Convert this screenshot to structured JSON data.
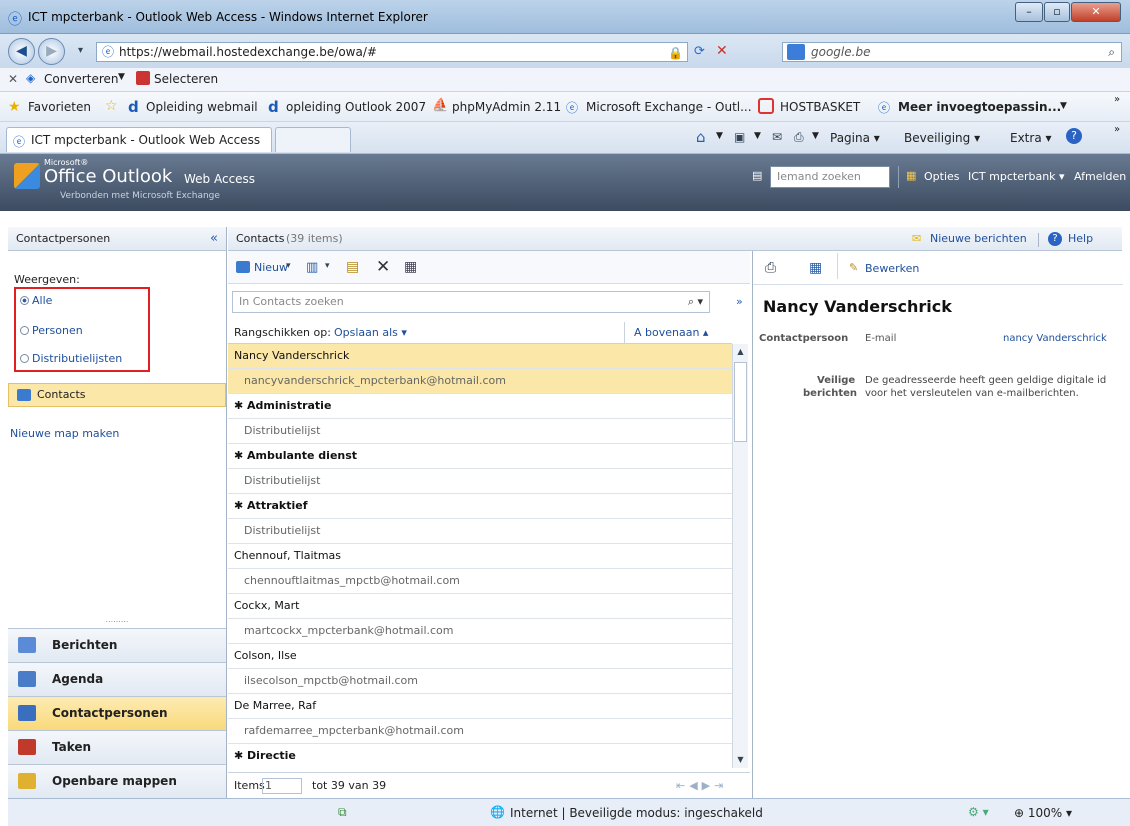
{
  "window": {
    "title": "ICT mpcterbank - Outlook Web Access - Windows Internet Explorer"
  },
  "address": {
    "url": "https://webmail.hostedexchange.be/owa/#"
  },
  "search": {
    "value": "google.be"
  },
  "conv": {
    "convert_label": "Converteren",
    "select_label": "Selecteren"
  },
  "favorites": {
    "label": "Favorieten",
    "items": [
      "Opleiding webmail",
      "opleiding Outlook 2007",
      "phpMyAdmin 2.11",
      "Microsoft Exchange - Outl...",
      "HOSTBASKET",
      "Meer invoegtoepassin..."
    ]
  },
  "tabs": {
    "active": "ICT mpcterbank - Outlook Web Access",
    "pagina": "Pagina",
    "beveiliging": "Beveiliging",
    "extra": "Extra"
  },
  "owa": {
    "logo_small": "Microsoft®",
    "logo_main": "Office Outlook",
    "logo_sub": "Web Access",
    "connected": "Verbonden met Microsoft Exchange",
    "search_placeholder": "Iemand zoeken",
    "opties": "Opties",
    "user": "ICT mpcterbank",
    "afmelden": "Afmelden"
  },
  "left": {
    "header": "Contactpersonen",
    "weergeven": "Weergeven:",
    "options": [
      "Alle",
      "Personen",
      "Distributielijsten"
    ],
    "contacts_folder": "Contacts",
    "new_folder": "Nieuwe map maken",
    "nav": [
      "Berichten",
      "Agenda",
      "Contactpersonen",
      "Taken",
      "Openbare mappen"
    ]
  },
  "main": {
    "title": "Contacts",
    "count": "(39 items)",
    "new_messages": "Nieuwe berichten",
    "help": "Help",
    "new_button": "Nieuw",
    "search_placeholder": "In Contacts zoeken",
    "sort_label": "Rangschikken op:",
    "sort_value": "Opslaan als",
    "sort_order": "A bovenaan",
    "items_label": "Items",
    "items_value": "1",
    "items_range": "tot 39 van 39"
  },
  "rows": [
    {
      "type": "name sel",
      "text": "Nancy Vanderschrick"
    },
    {
      "type": "sub sel",
      "text": "nancyvanderschrick_mpcterbank@hotmail.com"
    },
    {
      "type": "grp",
      "text": "Administratie"
    },
    {
      "type": "sub",
      "text": "Distributielijst"
    },
    {
      "type": "grp",
      "text": "Ambulante dienst"
    },
    {
      "type": "sub",
      "text": "Distributielijst"
    },
    {
      "type": "grp",
      "text": "Attraktief"
    },
    {
      "type": "sub",
      "text": "Distributielijst"
    },
    {
      "type": "name",
      "text": "Chennouf, Tlaitmas"
    },
    {
      "type": "sub",
      "text": "chennouftlaitmas_mpctb@hotmail.com"
    },
    {
      "type": "name",
      "text": "Cockx, Mart"
    },
    {
      "type": "sub",
      "text": "martcockx_mpcterbank@hotmail.com"
    },
    {
      "type": "name",
      "text": "Colson, Ilse"
    },
    {
      "type": "sub",
      "text": "ilsecolson_mpctb@hotmail.com"
    },
    {
      "type": "name",
      "text": "De Marree, Raf"
    },
    {
      "type": "sub",
      "text": "rafdemarree_mpcterbank@hotmail.com"
    },
    {
      "type": "grp",
      "text": "Directie"
    }
  ],
  "reading": {
    "edit": "Bewerken",
    "name": "Nancy Vanderschrick",
    "contact_label": "Contactpersoon",
    "email_label": "E-mail",
    "email_value": "nancy Vanderschrick",
    "secure_label_1": "Veilige",
    "secure_label_2": "berichten",
    "secure_text_1": "De geadresseerde heeft geen geldige digitale id",
    "secure_text_2": "voor het versleutelen van e-mailberichten."
  },
  "statusbar": {
    "zone": "Internet | Beveiligde modus: ingeschakeld",
    "zoom": "100%"
  },
  "colors": {
    "selection": "#fbe7a8",
    "header": "#4f5f75",
    "highlight_box": "#e02020"
  }
}
